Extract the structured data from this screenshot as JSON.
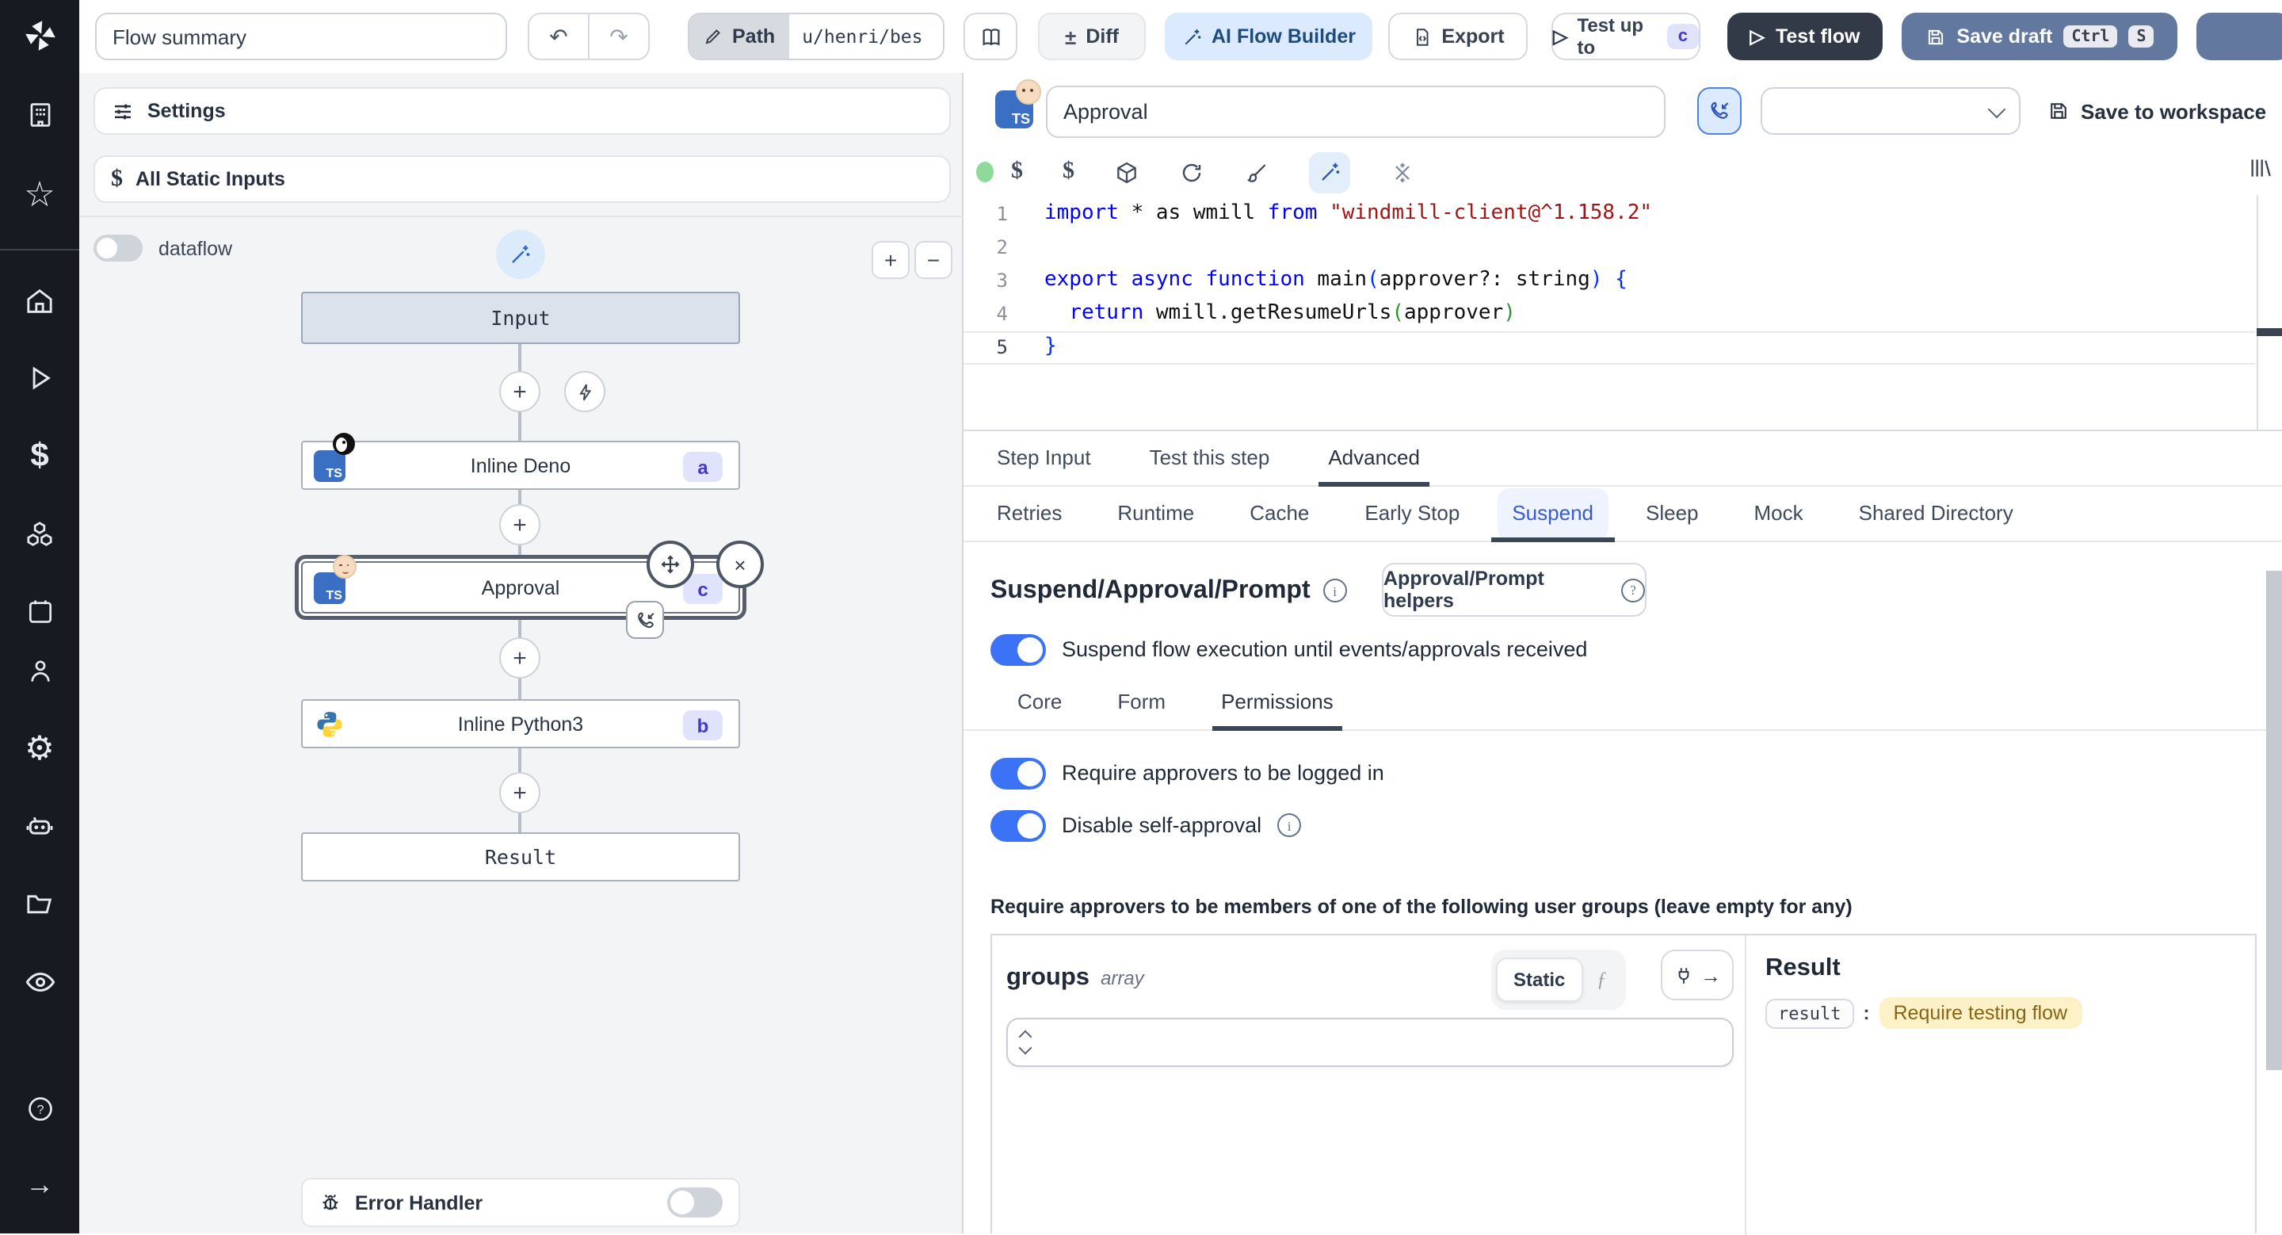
{
  "topbar": {
    "flow_summary": "Flow summary",
    "path_label": "Path",
    "path_value": "u/henri/bes",
    "diff": "Diff",
    "ai_flow_builder": "AI Flow Builder",
    "export": "Export",
    "test_up_to": "Test up to",
    "test_up_to_badge": "c",
    "test_flow": "Test flow",
    "save_draft": "Save draft",
    "kbd_ctrl": "Ctrl",
    "kbd_s": "S"
  },
  "rail": {
    "icons": [
      "windmill-logo",
      "workspace",
      "favorites",
      "home",
      "runs",
      "variables",
      "resources",
      "schedules",
      "users",
      "settings",
      "workers",
      "folders",
      "audit-logs",
      "help",
      "expand"
    ]
  },
  "flow_panel": {
    "settings": "Settings",
    "all_static_inputs": "All Static Inputs",
    "dataflow": "dataflow",
    "zoom_in": "+",
    "zoom_out": "−",
    "error_handler": "Error Handler",
    "nodes": {
      "input": "Input",
      "deno": {
        "label": "Inline Deno",
        "badge": "a"
      },
      "approval": {
        "label": "Approval",
        "badge": "c"
      },
      "python": {
        "label": "Inline Python3",
        "badge": "b"
      },
      "result": "Result"
    }
  },
  "editor": {
    "step_name": "Approval",
    "save_to_workspace": "Save to workspace",
    "code_lines": [
      {
        "n": "1",
        "seg": [
          [
            "import",
            "k"
          ],
          [
            " * as wmill ",
            "d"
          ],
          [
            "from",
            "k"
          ],
          [
            " ",
            "d"
          ],
          [
            "\"windmill-client@^1.158.2\"",
            "s"
          ]
        ]
      },
      {
        "n": "2",
        "seg": []
      },
      {
        "n": "3",
        "seg": [
          [
            "export",
            "k"
          ],
          [
            " ",
            "d"
          ],
          [
            "async",
            "k"
          ],
          [
            " ",
            "d"
          ],
          [
            "function",
            "k"
          ],
          [
            " main",
            "d"
          ],
          [
            "(",
            "b1"
          ],
          [
            "approver?: string",
            "d"
          ],
          [
            ")",
            "b1"
          ],
          [
            " {",
            "b1"
          ]
        ]
      },
      {
        "n": "4",
        "seg": [
          [
            "  ",
            "d"
          ],
          [
            "return",
            "k"
          ],
          [
            " wmill.getResumeUrls",
            "d"
          ],
          [
            "(",
            "b2"
          ],
          [
            "approver",
            "d"
          ],
          [
            ")",
            "b2"
          ]
        ]
      },
      {
        "n": "5",
        "seg": [
          [
            "}",
            "b1"
          ]
        ]
      }
    ]
  },
  "tabs": {
    "main": {
      "items": [
        "Step Input",
        "Test this step",
        "Advanced"
      ],
      "active": 2
    },
    "advanced": {
      "items": [
        "Retries",
        "Runtime",
        "Cache",
        "Early Stop",
        "Suspend",
        "Sleep",
        "Mock",
        "Shared Directory"
      ],
      "active": 4
    },
    "form": {
      "items": [
        "Core",
        "Form",
        "Permissions"
      ],
      "active": 2
    }
  },
  "suspend": {
    "title": "Suspend/Approval/Prompt",
    "helpers_button": "Approval/Prompt helpers",
    "toggle_suspend": "Suspend flow execution until events/approvals received",
    "toggle_logged_in": "Require approvers to be logged in",
    "toggle_self_approval": "Disable self-approval",
    "groups_hint": "Require approvers to be members of one of the following user groups (leave empty for any)",
    "groups": {
      "name": "groups",
      "type": "array",
      "static_label": "Static"
    },
    "result": {
      "title": "Result",
      "key": "result",
      "value": "Require testing flow"
    }
  },
  "colors": {
    "accent_toggle": "#3b72f6",
    "badge_bg": "#dfe3fc",
    "badge_text": "#4338ca",
    "ai_button_bg": "#dbeafe",
    "ai_button_text": "#1d4c7f",
    "save_draft_bg": "#63789f",
    "dark_button_bg": "#323947",
    "amber_bg": "#fdf2c7",
    "amber_text": "#8a6414",
    "code": {
      "k": "#0000ff",
      "d": "#111111",
      "s": "#a31515",
      "b1": "#0431fa",
      "b2": "#319331"
    }
  }
}
